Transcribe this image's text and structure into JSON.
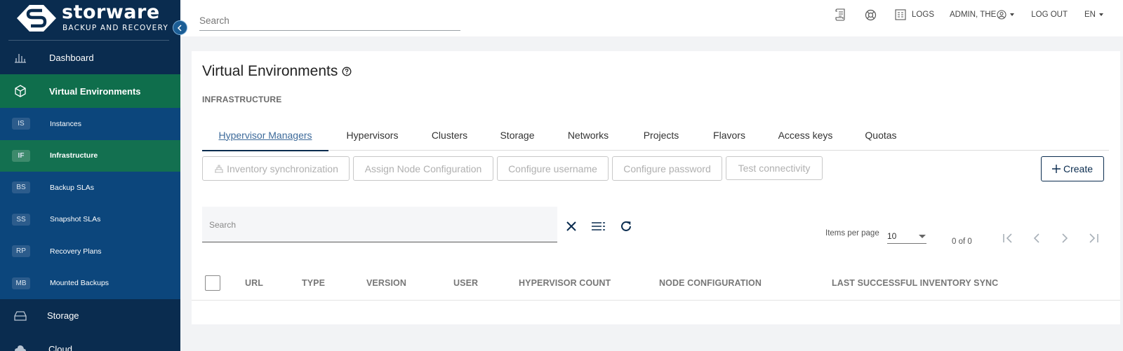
{
  "brand": {
    "name": "storware",
    "tagline": "BACKUP AND RECOVERY"
  },
  "search": {
    "placeholder": "Search"
  },
  "header": {
    "logs_label": "LOGS",
    "user_label": "ADMIN, THE",
    "logout_label": "LOG OUT",
    "language_label": "EN"
  },
  "sidebar": {
    "dashboard": "Dashboard",
    "virtual_environments": "Virtual Environments",
    "sub_items": [
      {
        "abbr": "IS",
        "label": "Instances"
      },
      {
        "abbr": "IF",
        "label": "Infrastructure"
      },
      {
        "abbr": "BS",
        "label": "Backup SLAs"
      },
      {
        "abbr": "SS",
        "label": "Snapshot SLAs"
      },
      {
        "abbr": "RP",
        "label": "Recovery Plans"
      },
      {
        "abbr": "MB",
        "label": "Mounted Backups"
      }
    ],
    "storage": "Storage",
    "cloud": "Cloud"
  },
  "page": {
    "title": "Virtual Environments",
    "breadcrumb": "INFRASTRUCTURE"
  },
  "tabs": [
    "Hypervisor Managers",
    "Hypervisors",
    "Clusters",
    "Storage",
    "Networks",
    "Projects",
    "Flavors",
    "Access keys",
    "Quotas"
  ],
  "actions": {
    "inventory_sync": "Inventory synchronization",
    "assign_node_config": "Assign Node Configuration",
    "configure_username": "Configure username",
    "configure_password": "Configure password",
    "test_connectivity": "Test connectivity",
    "create": "Create"
  },
  "table_search": {
    "placeholder": "Search"
  },
  "pagination": {
    "items_per_page_label": "Items per page",
    "items_per_page_value": "10",
    "range": "0 of 0"
  },
  "table": {
    "columns": [
      "URL",
      "TYPE",
      "VERSION",
      "USER",
      "HYPERVISOR COUNT",
      "NODE CONFIGURATION",
      "LAST SUCCESSFUL INVENTORY SYNC"
    ]
  },
  "colors": {
    "sidebar_bg": "#0a2c4f",
    "sidebar_sub_bg": "#0c467c",
    "active_green": "#0f6e4c",
    "accent": "#0a2c4f",
    "link": "#3d6a9a"
  }
}
